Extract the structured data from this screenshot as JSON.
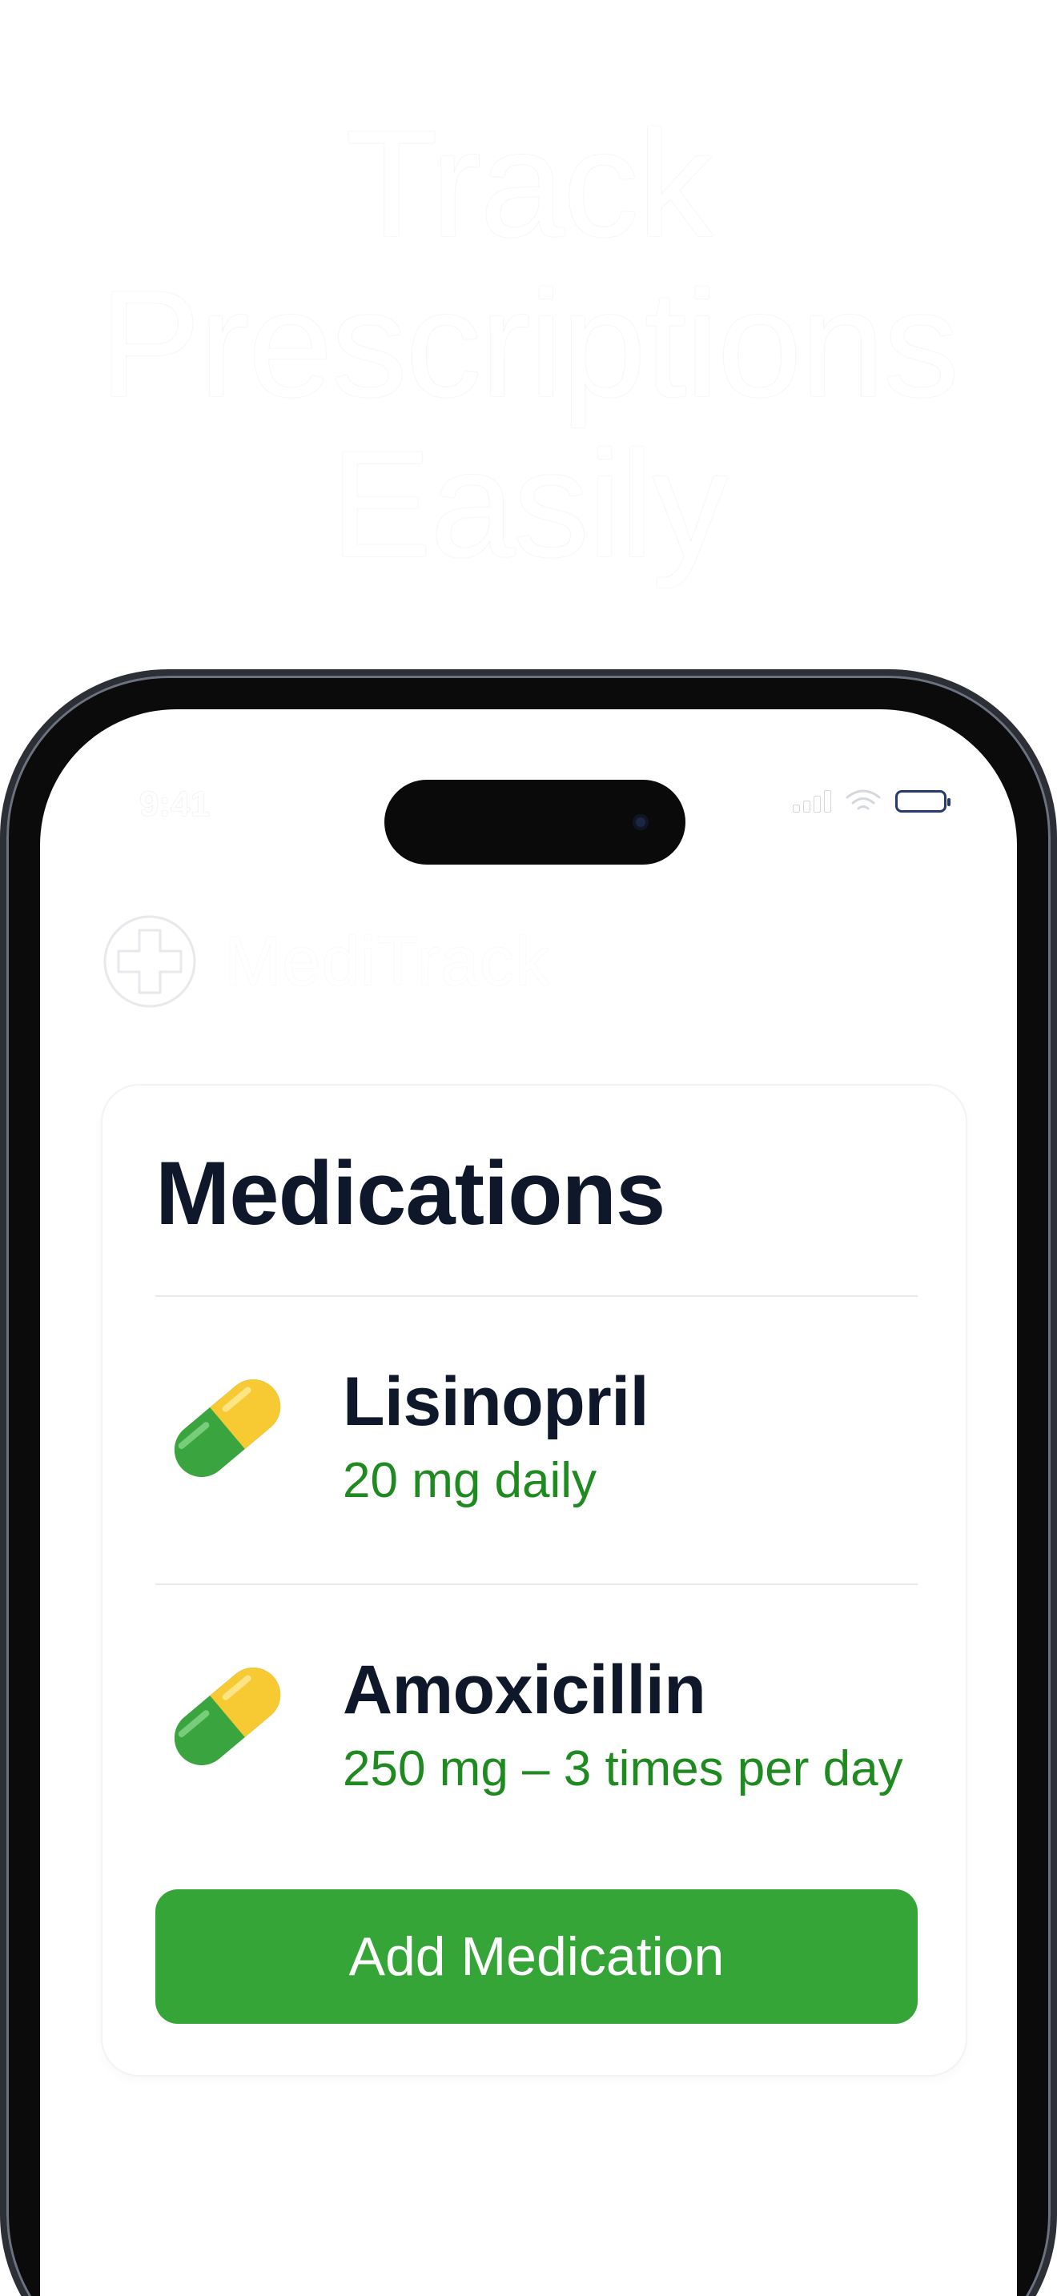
{
  "headline": {
    "line1": "Track",
    "line2": "Prescriptions",
    "line3": "Easily"
  },
  "status_bar": {
    "time": "9:41"
  },
  "app": {
    "name": "MediTrack"
  },
  "card": {
    "title": "Medications",
    "medications": [
      {
        "name": "Lisinopril",
        "dose": "20 mg daily"
      },
      {
        "name": "Amoxicillin",
        "dose": "250 mg – 3 times per day"
      }
    ],
    "add_button_label": "Add Medication"
  },
  "colors": {
    "accent_green": "#35a537",
    "dose_text_green": "#1f8a20",
    "pill_yellow": "#f7c932",
    "pill_green": "#3aa53e",
    "title_text": "#0f172a"
  },
  "icons": {
    "app_logo": "medical-cross-icon",
    "pill": "capsule-icon"
  }
}
